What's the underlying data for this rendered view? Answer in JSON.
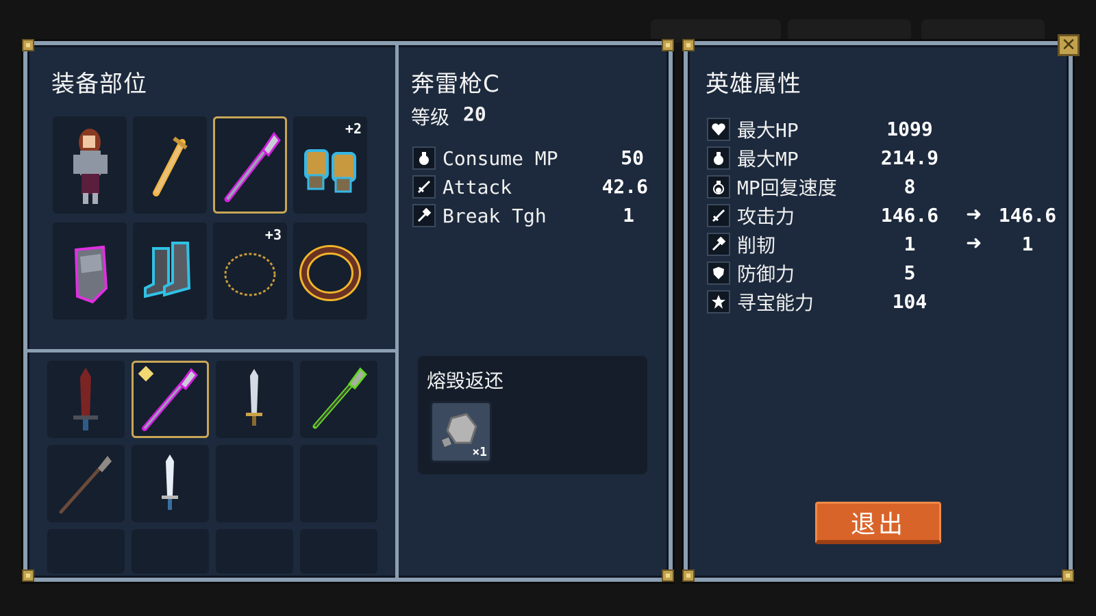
{
  "equipment_panel": {
    "title": "装备部位",
    "slots": [
      {
        "icon": "hero-portrait-icon",
        "badge": ""
      },
      {
        "icon": "golden-sword-icon",
        "badge": ""
      },
      {
        "icon": "thunder-spear-icon",
        "badge": "",
        "selected": true
      },
      {
        "icon": "golden-gauntlets-icon",
        "badge": "+2"
      },
      {
        "icon": "steel-armor-icon",
        "badge": ""
      },
      {
        "icon": "steel-boots-icon",
        "badge": ""
      },
      {
        "icon": "golden-necklace-icon",
        "badge": "+3"
      },
      {
        "icon": "bronze-ring-icon",
        "badge": ""
      }
    ],
    "inventory": [
      {
        "icon": "red-greatsword-icon"
      },
      {
        "icon": "thunder-spear-icon",
        "selected": true,
        "new": true
      },
      {
        "icon": "silver-shortsword-icon"
      },
      {
        "icon": "green-spear-icon"
      },
      {
        "icon": "iron-spear-icon"
      },
      {
        "icon": "white-dagger-icon"
      },
      {
        "icon": ""
      },
      {
        "icon": ""
      },
      {
        "icon": ""
      },
      {
        "icon": ""
      },
      {
        "icon": ""
      },
      {
        "icon": ""
      }
    ]
  },
  "item_detail": {
    "name": "奔雷枪C",
    "level_label": "等级",
    "level_value": "20",
    "stats": [
      {
        "icon": "potion-icon",
        "label": "Consume MP",
        "value": "50"
      },
      {
        "icon": "sword-icon",
        "label": "Attack",
        "value": "42.6"
      },
      {
        "icon": "hammer-icon",
        "label": "Break Tgh",
        "value": "1"
      }
    ],
    "smelt": {
      "title": "熔毁返还",
      "material_icon": "stone-ore-icon",
      "quantity": "×1"
    }
  },
  "hero_attributes": {
    "title": "英雄属性",
    "stats": [
      {
        "icon": "heart-icon",
        "label": "最大HP",
        "value": "1099",
        "next": ""
      },
      {
        "icon": "potion-icon",
        "label": "最大MP",
        "value": "214.9",
        "next": ""
      },
      {
        "icon": "potion-regen-icon",
        "label": "MP回复速度",
        "value": "8",
        "next": ""
      },
      {
        "icon": "sword-icon",
        "label": "攻击力",
        "value": "146.6",
        "next": "146.6"
      },
      {
        "icon": "hammer-icon",
        "label": "削韧",
        "value": "1",
        "next": "1"
      },
      {
        "icon": "shield-icon",
        "label": "防御力",
        "value": "5",
        "next": ""
      },
      {
        "icon": "star-icon",
        "label": "寻宝能力",
        "value": "104",
        "next": ""
      }
    ],
    "arrow": "➜",
    "exit_label": "退出"
  },
  "close_label": "✕",
  "colors": {
    "panel_bg": "#1d2a3d",
    "panel_border": "#8c9fb3",
    "accent_gold": "#c9a656",
    "exit_button": "#d9642a"
  }
}
